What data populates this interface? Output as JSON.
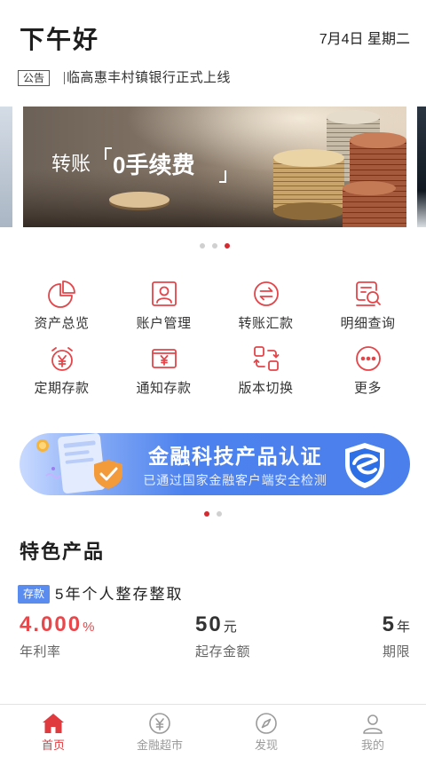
{
  "header": {
    "greeting": "下午好",
    "date": "7月4日 星期二"
  },
  "notice": {
    "badge": "公告",
    "text": "临高惠丰村镇银行正式上线"
  },
  "banner": {
    "prefix": "转账",
    "highlight": "0手续费",
    "indicator": {
      "count": 3,
      "active": 3
    }
  },
  "quick_menu": [
    {
      "label": "资产总览",
      "icon": "pie-chart-icon"
    },
    {
      "label": "账户管理",
      "icon": "account-card-icon"
    },
    {
      "label": "转账汇款",
      "icon": "transfer-icon"
    },
    {
      "label": "明细查询",
      "icon": "statement-search-icon"
    },
    {
      "label": "定期存款",
      "icon": "alarm-clock-yuan-icon"
    },
    {
      "label": "通知存款",
      "icon": "yuan-card-icon"
    },
    {
      "label": "版本切换",
      "icon": "switch-version-icon"
    },
    {
      "label": "更多",
      "icon": "more-icon"
    }
  ],
  "promo": {
    "title": "金融科技产品认证",
    "subtitle": "已通过国家金融客户端安全检测",
    "indicator": {
      "count": 2,
      "active": 1
    }
  },
  "featured": {
    "section_title": "特色产品",
    "product": {
      "tag": "存款",
      "name": "5年个人整存整取",
      "rate": {
        "value": "4.000",
        "unit": "%",
        "label": "年利率"
      },
      "min_deposit": {
        "value": "50",
        "unit": "元",
        "label": "起存金额"
      },
      "term": {
        "value": "5",
        "unit": "年",
        "label": "期限"
      }
    }
  },
  "tabbar": [
    {
      "label": "首页",
      "icon": "home-icon",
      "active": true
    },
    {
      "label": "金融超市",
      "icon": "yuan-circle-icon",
      "active": false
    },
    {
      "label": "发现",
      "icon": "compass-icon",
      "active": false
    },
    {
      "label": "我的",
      "icon": "person-icon",
      "active": false
    }
  ],
  "colors": {
    "accent": "#e03a3e",
    "icon_red": "#e2464a",
    "rate_red": "#e8474b",
    "promo_blue": "#4d82ee",
    "tag_blue": "#5a8cf0"
  }
}
